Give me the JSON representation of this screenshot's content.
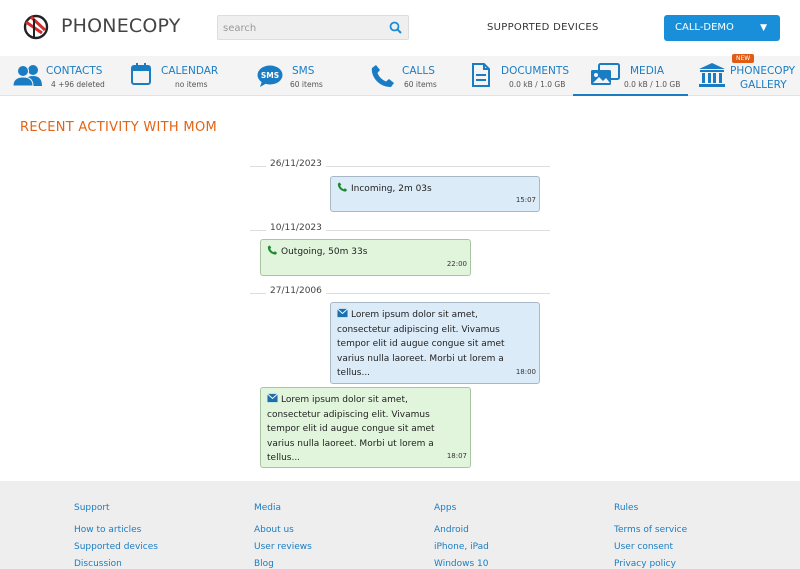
{
  "header": {
    "logo_text": "PHONECOPY",
    "search_placeholder": "search",
    "supported_devices": "SUPPORTED DEVICES",
    "demo_button": "CALL-DEMO",
    "caret": "▼"
  },
  "nav": {
    "contacts": {
      "label": "CONTACTS",
      "sub": "4 +96 deleted"
    },
    "calendar": {
      "label": "CALENDAR",
      "sub": "no items"
    },
    "sms": {
      "label": "SMS",
      "sub": "60 items",
      "icon_text": "SMS"
    },
    "calls": {
      "label": "CALLS",
      "sub": "60 items"
    },
    "documents": {
      "label": "DOCUMENTS",
      "sub": "0.0 kB / 1.0 GB"
    },
    "media": {
      "label": "MEDIA",
      "sub": "0.0 kB / 1.0 GB"
    },
    "gallery": {
      "label1": "PHONECOPY",
      "label2": "GALLERY",
      "badge": "NEW"
    },
    "accent_color": "#1a7dc4"
  },
  "main": {
    "title": "RECENT ACTIVITY WITH MOM",
    "dates": [
      "26/11/2023",
      "10/11/2023",
      "27/11/2006"
    ],
    "messages": [
      {
        "type": "call",
        "direction": "incoming",
        "text": "Incoming, 2m 03s",
        "time": "15:07"
      },
      {
        "type": "call",
        "direction": "outgoing",
        "text": "Outgoing, 50m 33s",
        "time": "22:00"
      },
      {
        "type": "sms",
        "direction": "incoming",
        "text": "Lorem ipsum dolor sit amet, consectetur adipiscing elit. Vivamus tempor elit id augue congue sit amet varius nulla laoreet. Morbi ut lorem a tellus...",
        "time": "18:00"
      },
      {
        "type": "sms",
        "direction": "outgoing",
        "text": "Lorem ipsum dolor sit amet, consectetur adipiscing elit. Vivamus tempor elit id augue congue sit amet varius nulla laoreet. Morbi ut lorem a tellus...",
        "time": "18:07"
      }
    ]
  },
  "footer": {
    "columns": [
      {
        "heading": "Support",
        "links": [
          "How to articles",
          "Supported devices",
          "Discussion"
        ]
      },
      {
        "heading": "Media",
        "links": [
          "About us",
          "User reviews",
          "Blog"
        ]
      },
      {
        "heading": "Apps",
        "links": [
          "Android",
          "iPhone, iPad",
          "Windows 10"
        ]
      },
      {
        "heading": "Rules",
        "links": [
          "Terms of service",
          "User consent",
          "Privacy policy"
        ]
      }
    ]
  }
}
